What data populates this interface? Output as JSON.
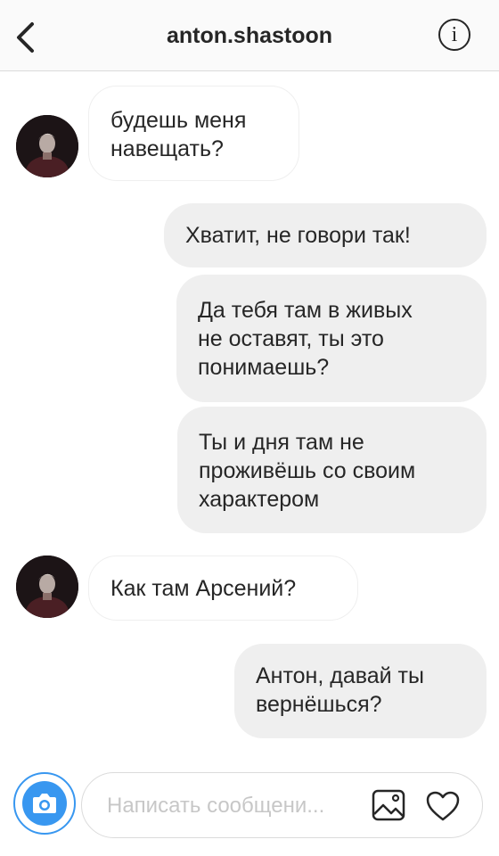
{
  "header": {
    "username": "anton.shastoon",
    "back_icon": "chevron-left-icon",
    "info_icon": "info-icon",
    "info_glyph": "i"
  },
  "messages": [
    {
      "direction": "incoming",
      "lines": [
        "будешь меня",
        "навещать?"
      ]
    },
    {
      "direction": "outgoing",
      "lines": [
        "Хватит, не говори так!"
      ]
    },
    {
      "direction": "outgoing",
      "lines": [
        "Да тебя там в живых",
        "не оставят, ты это",
        "понимаешь?"
      ]
    },
    {
      "direction": "outgoing",
      "lines": [
        "Ты и дня там не",
        "проживёшь со своим",
        "характером"
      ]
    },
    {
      "direction": "incoming",
      "lines": [
        "Как там Арсений?"
      ]
    },
    {
      "direction": "outgoing",
      "lines": [
        "Антон, давай ты",
        "вернёшься?"
      ]
    }
  ],
  "composer": {
    "placeholder": "Написать сообщени...",
    "camera_icon": "camera-icon",
    "gallery_icon": "gallery-icon",
    "heart_icon": "heart-icon"
  },
  "colors": {
    "accent": "#3897f0",
    "outgoing_bubble": "#efefef",
    "incoming_border": "#efefef",
    "text": "#262626",
    "placeholder": "#c7c7c7"
  }
}
